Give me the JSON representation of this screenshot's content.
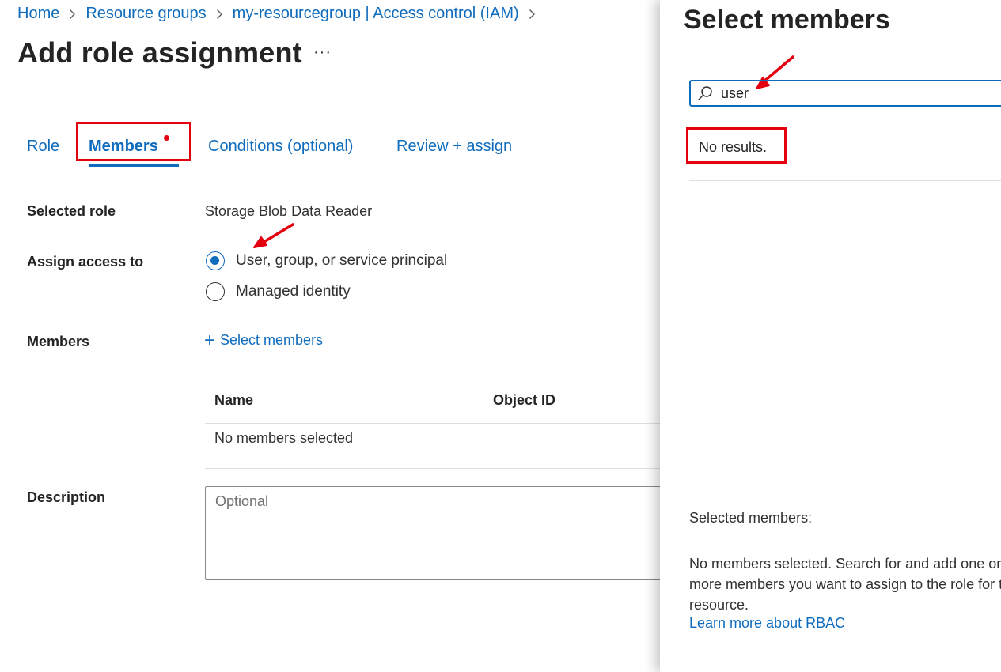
{
  "breadcrumb": {
    "items": [
      "Home",
      "Resource groups",
      "my-resourcegroup | Access control (IAM)"
    ]
  },
  "page": {
    "title": "Add role assignment",
    "more_label": "···"
  },
  "tabs": [
    {
      "label": "Role"
    },
    {
      "label": "Members",
      "active": true
    },
    {
      "label": "Conditions (optional)"
    },
    {
      "label": "Review + assign"
    }
  ],
  "form": {
    "selected_role_label": "Selected role",
    "selected_role_value": "Storage Blob Data Reader",
    "assign_access_label": "Assign access to",
    "options": [
      {
        "label": "User, group, or service principal",
        "checked": true
      },
      {
        "label": "Managed identity",
        "checked": false
      }
    ],
    "members_label": "Members",
    "select_members_link": "Select members",
    "table": {
      "columns": [
        "Name",
        "Object ID"
      ],
      "empty_text": "No members selected"
    },
    "description_label": "Description",
    "description_placeholder": "Optional"
  },
  "panel": {
    "title": "Select members",
    "search_value": "user",
    "no_results": "No results.",
    "selected_members_label": "Selected members:",
    "selected_members_message": "No members selected. Search for and add one or more members you want to assign to the role for this resource.",
    "learn_more_link": "Learn more about RBAC"
  },
  "colors": {
    "accent": "#0f6cbd",
    "annotation": "#e3000f",
    "text": "#323130"
  }
}
